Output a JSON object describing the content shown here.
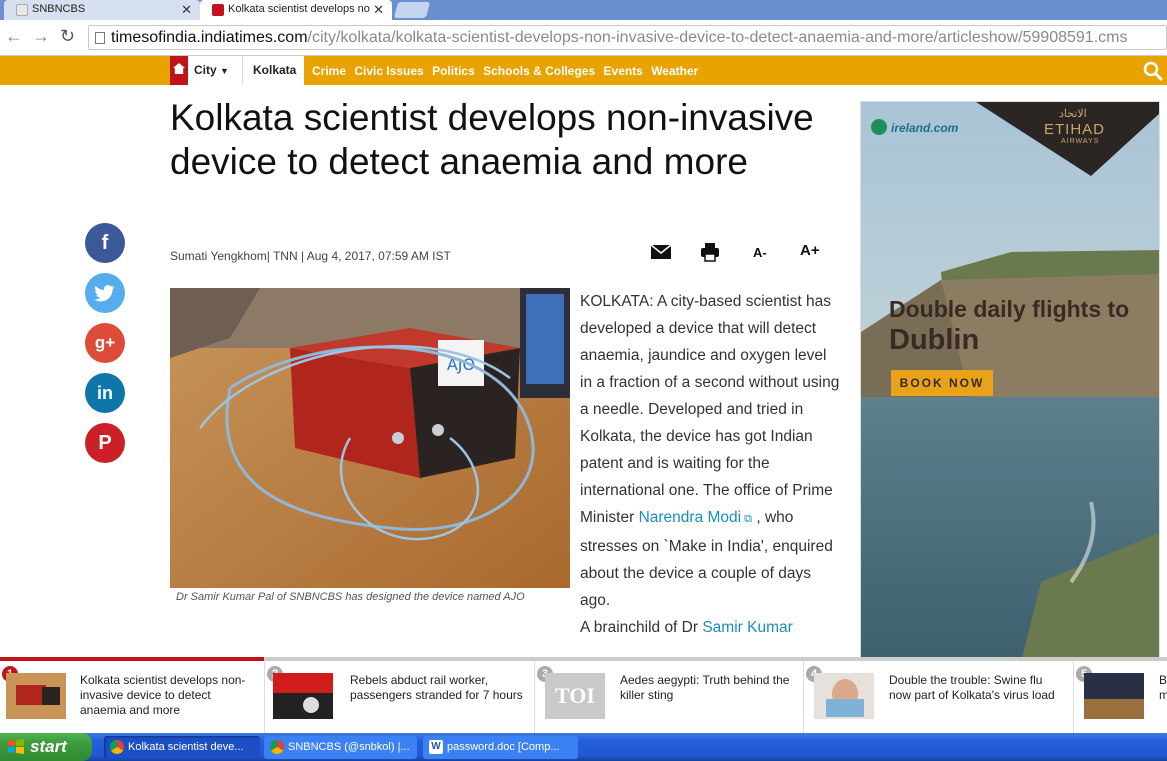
{
  "browser": {
    "tabs": [
      {
        "title": "SNBNCBS",
        "active": false
      },
      {
        "title": "Kolkata scientist develops no",
        "active": true
      }
    ],
    "close_glyph": "✕",
    "url_host": "timesofindia.indiatimes.com",
    "url_path": "/city/kolkata/kolkata-scientist-develops-non-invasive-device-to-detect-anaemia-and-more/articleshow/59908591.cms"
  },
  "site_nav": {
    "city_label": "City",
    "section_label": "Kolkata",
    "links": [
      "Crime",
      "Civic Issues",
      "Politics",
      "Schools & Colleges",
      "Events",
      "Weather"
    ],
    "accent": "#e9a300",
    "home_color": "#c0131b"
  },
  "article": {
    "headline": "Kolkata scientist develops non-invasive device to detect anaemia and more",
    "byline": "Sumati Yengkhom| TNN | Aug 4, 2017, 07:59 AM IST",
    "tools": {
      "font_smaller": "A-",
      "font_larger": "A+"
    },
    "caption": "Dr Samir Kumar Pal of SNBNCBS has designed the device named AJO",
    "body_before": "KOLKATA: A city-based scientist has developed a device that will detect anaemia, jaundice and oxygen level in a fraction of a second without using a needle. Developed and tried in Kolkata, the device has got Indian patent and is waiting for the international one. The office of Prime Minister ",
    "body_link": "Narendra Modi",
    "body_after": " , who stresses on `Make in India', enquired about the device a couple of days ago.",
    "body_next_before": "A brainchild of Dr ",
    "body_next_link": "Samir Kumar"
  },
  "social": [
    {
      "name": "facebook",
      "glyph": "f"
    },
    {
      "name": "twitter",
      "glyph": ""
    },
    {
      "name": "google-plus",
      "glyph": "g+"
    },
    {
      "name": "linkedin",
      "glyph": "in"
    },
    {
      "name": "pinterest",
      "glyph": "P"
    }
  ],
  "ad": {
    "partner": "ireland.com",
    "airline": "ETIHAD",
    "airline_sub": "AIRWAYS",
    "airline_arabic": "الاتحاد",
    "headline_line1": "Double daily flights to",
    "headline_line2": "Dublin",
    "cta": "BOOK NOW"
  },
  "trending": [
    {
      "num": "1",
      "title": "Kolkata scientist develops non-invasive device to detect anaemia and more"
    },
    {
      "num": "2",
      "title": "Rebels abduct rail worker, passengers stranded for 7 hours"
    },
    {
      "num": "3",
      "title": "Aedes aegypti: Truth behind the killer sting",
      "thumb_text": "TOI"
    },
    {
      "num": "4",
      "title": "Double the trouble: Swine flu now part of Kolkata's virus load"
    },
    {
      "num": "5",
      "title": "B m"
    }
  ],
  "taskbar": {
    "start_label": "start",
    "tasks": [
      "Kolkata scientist deve...",
      "SNBNCBS (@snbkol) |...",
      "password.doc [Comp..."
    ]
  }
}
